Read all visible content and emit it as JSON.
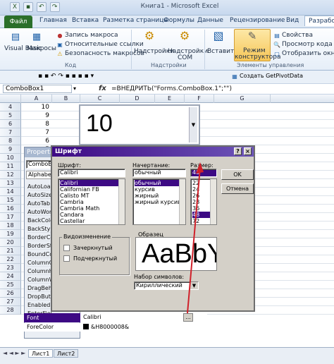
{
  "window": {
    "title": "Книга1 - Microsoft Excel"
  },
  "tabs": [
    {
      "label": "Файл"
    },
    {
      "label": "Главная"
    },
    {
      "label": "Вставка"
    },
    {
      "label": "Разметка страницы"
    },
    {
      "label": "Формулы"
    },
    {
      "label": "Данные"
    },
    {
      "label": "Рецензирование"
    },
    {
      "label": "Вид"
    },
    {
      "label": "Разработ"
    }
  ],
  "ribbon": {
    "code": {
      "visual_basic": "Visual Basic",
      "macros": "Макросы",
      "record_macro": "Запись макроса",
      "relative_refs": "Относительные ссылки",
      "macro_security": "Безопасность макросов",
      "group_name": "Код"
    },
    "addins": {
      "addins": "Надстройки",
      "com_addins_1": "Надстройки",
      "com_addins_2": "COM",
      "group_name": "Надстройки"
    },
    "controls": {
      "insert": "Вставить",
      "design_mode_1": "Режим",
      "design_mode_2": "конструктора",
      "properties": "Свойства",
      "view_code": "Просмотр кода",
      "show_window": "Отобразить окно",
      "group_name": "Элементы управления"
    }
  },
  "toolbar": {
    "get_pivot_data": "Создать GetPivotData"
  },
  "formula_bar": {
    "name_box": "ComboBox1",
    "fx": "fx",
    "formula": "=ВНЕДРИТЬ(\"Forms.ComboBox.1\";\"\")"
  },
  "columns": [
    "A",
    "B",
    "C",
    "D",
    "E",
    "F",
    "G"
  ],
  "rows": [
    {
      "num": "4",
      "a": "10"
    },
    {
      "num": "5",
      "a": "9"
    },
    {
      "num": "6",
      "a": "8"
    },
    {
      "num": "7",
      "a": "7"
    },
    {
      "num": "8",
      "a": "6"
    },
    {
      "num": "9",
      "a": "5"
    },
    {
      "num": "10",
      "a": ""
    },
    {
      "num": "11",
      "a": ""
    },
    {
      "num": "12",
      "a": ""
    },
    {
      "num": "13",
      "a": ""
    },
    {
      "num": "14",
      "a": ""
    },
    {
      "num": "15",
      "a": ""
    },
    {
      "num": "16",
      "a": ""
    },
    {
      "num": "17",
      "a": ""
    },
    {
      "num": "18",
      "a": ""
    },
    {
      "num": "19",
      "a": ""
    },
    {
      "num": "20",
      "a": ""
    },
    {
      "num": "21",
      "a": ""
    },
    {
      "num": "22",
      "a": ""
    },
    {
      "num": "23",
      "a": ""
    },
    {
      "num": "24",
      "a": ""
    },
    {
      "num": "25",
      "a": ""
    },
    {
      "num": "26",
      "a": ""
    },
    {
      "num": "27",
      "a": ""
    },
    {
      "num": "28",
      "a": ""
    }
  ],
  "combobox": {
    "value": "10"
  },
  "properties": {
    "title": "Properties",
    "object": "ComboBo",
    "tab": "Alphabeti",
    "items": [
      "AutoLoad",
      "AutoSize",
      "AutoTab",
      "AutoWord",
      "BackColor",
      "BackStyle",
      "BorderCo",
      "BorderSty",
      "BoundCo",
      "ColumnCo",
      "ColumnHe",
      "ColumnWi",
      "DragBeha",
      "DropButt",
      "Enabled",
      "EnterFiel"
    ],
    "font_name": "Font",
    "font_value": "Calibri",
    "forecolor_name": "ForeColor",
    "forecolor_value": "&H800000​8&"
  },
  "font_dialog": {
    "title": "Шрифт",
    "font_label": "Шрифт:",
    "font_value": "Calibri",
    "fonts": [
      "Calibri",
      "Californian FB",
      "Calisto MT",
      "Cambria",
      "Cambria Math",
      "Candara",
      "Castellar"
    ],
    "style_label": "Начертание:",
    "style_value": "обычный",
    "styles": [
      "обычный",
      "курсив",
      "жирный",
      "жирный курсив"
    ],
    "size_label": "Размер:",
    "size_value": "48",
    "sizes": [
      "22",
      "24",
      "26",
      "28",
      "36",
      "48",
      "72"
    ],
    "ok": "OK",
    "cancel": "Отмена",
    "effects_label": "Видоизменение",
    "strikeout": "Зачеркнутый",
    "underline": "Подчеркнутый",
    "sample_label": "Образец",
    "sample_text": "AaBbYy",
    "charset_label": "Набор символов:",
    "charset_value": "Кириллический"
  },
  "sheets": [
    "Лист1",
    "Лист2"
  ],
  "colors": {
    "file_tab": "#2b6f2a",
    "dialog_title": "#3d0a84",
    "arrow": "#d0202a"
  }
}
